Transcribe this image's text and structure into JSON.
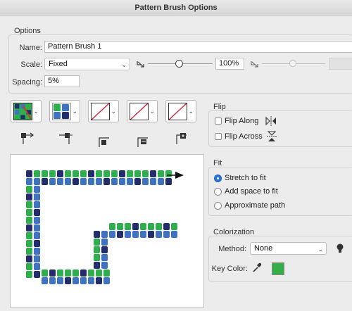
{
  "window": {
    "title": "Pattern Brush Options"
  },
  "options": {
    "group_label": "Options",
    "name_label": "Name:",
    "name_value": "Pattern Brush 1",
    "scale_label": "Scale:",
    "scale_mode": "Fixed",
    "scale_percent": "100%",
    "spacing_label": "Spacing:",
    "spacing_value": "5%"
  },
  "flip": {
    "group_label": "Flip",
    "along_label": "Flip Along",
    "across_label": "Flip Across"
  },
  "fit": {
    "group_label": "Fit",
    "options": [
      "Stretch to fit",
      "Add space to fit",
      "Approximate path"
    ],
    "selected": "Stretch to fit"
  },
  "colorization": {
    "group_label": "Colorization",
    "method_label": "Method:",
    "method_value": "None",
    "key_color_label": "Key Color:",
    "key_color": "#35ad48"
  },
  "tiles": [
    "side-tile",
    "outer-corner-tile",
    "inner-corner-tile",
    "start-tile",
    "end-tile"
  ],
  "colors": {
    "navy": "#242d6b",
    "blue": "#3f72c0",
    "green": "#2fae4e",
    "accent": "#2a73d8"
  }
}
